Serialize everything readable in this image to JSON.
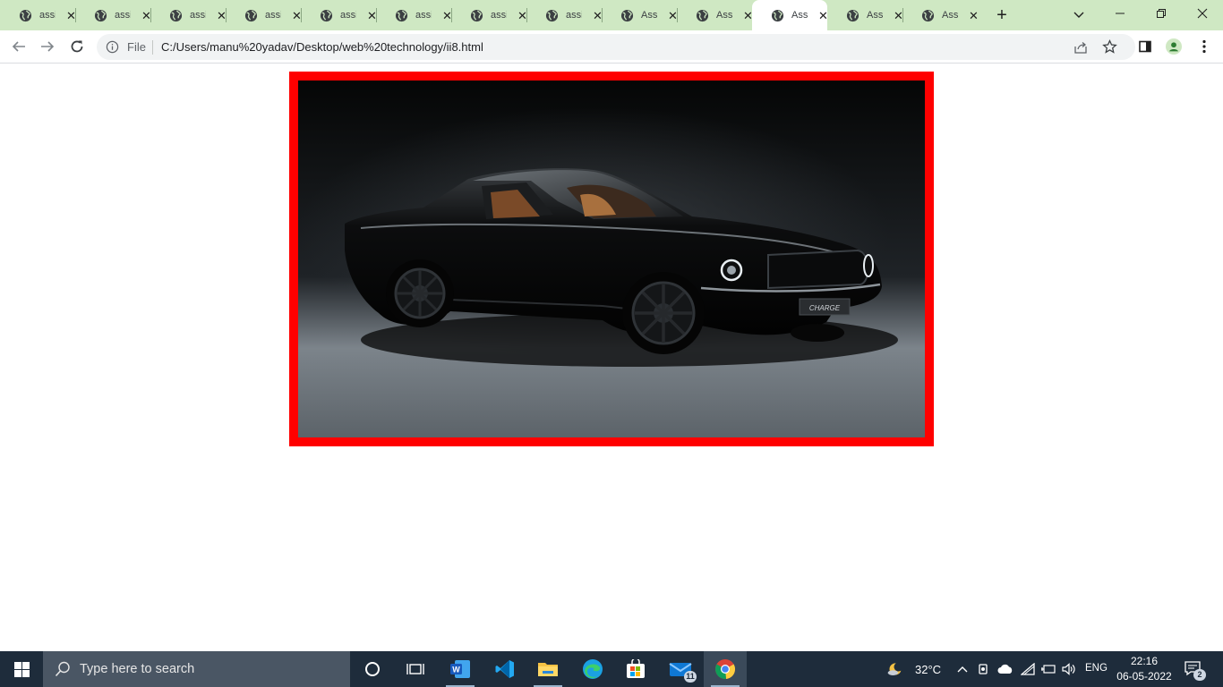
{
  "browser": {
    "tabs": [
      {
        "title": "assi",
        "active": false
      },
      {
        "title": "assi",
        "active": false
      },
      {
        "title": "assi",
        "active": false
      },
      {
        "title": "assi",
        "active": false
      },
      {
        "title": "assi",
        "active": false
      },
      {
        "title": "assi",
        "active": false
      },
      {
        "title": "assi",
        "active": false
      },
      {
        "title": "assi",
        "active": false
      },
      {
        "title": "Ass",
        "active": false
      },
      {
        "title": "Ass",
        "active": false
      },
      {
        "title": "Ass",
        "active": true
      },
      {
        "title": "Ass",
        "active": false
      },
      {
        "title": "Ass",
        "active": false
      }
    ],
    "tab_close_glyph": "✕",
    "new_tab_glyph": "+",
    "omnibox": {
      "scheme_label": "File",
      "url": "C:/Users/manu%20yadav/Desktop/web%20technology/ii8.html"
    },
    "colors": {
      "tab_strip": "#cfe8c3",
      "active_tab": "#ffffff"
    }
  },
  "page": {
    "image_alt": "Black classic fastback muscle car with CHARGE front plate",
    "plate_text": "CHARGE",
    "frame_color": "#ff0000"
  },
  "taskbar": {
    "search_placeholder": "Type here to search",
    "weather_temp": "32°C",
    "language": "ENG",
    "time": "22:16",
    "date": "06-05-2022",
    "mail_badge": "11",
    "notification_badge": "2",
    "apps": [
      "cortana-icon",
      "task-view-icon",
      "word-icon",
      "vscode-icon",
      "file-explorer-icon",
      "edge-icon",
      "microsoft-store-icon",
      "mail-icon",
      "chrome-icon"
    ]
  }
}
